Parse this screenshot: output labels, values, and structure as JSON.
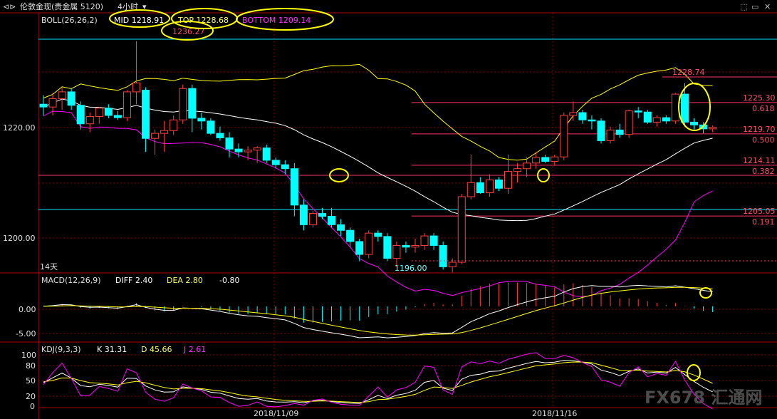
{
  "header": {
    "title": "伦敦金现(贵金属 5120)",
    "timeframe": "4小时",
    "timeframe_arrow": "▾",
    "nav_icon": "back-forward-icon",
    "window_icons": [
      "restore-icon",
      "window-icon",
      "close-icon"
    ]
  },
  "indicators": {
    "boll": {
      "label": "BOLL(26,26,2)",
      "mid": "MID 1218.91",
      "top": "TOP 1228.68",
      "bottom": "BOTTOM 1209.14"
    },
    "macd": {
      "label": "MACD(12,26,9)",
      "diff": "DIFF 2.40",
      "dea": "DEA 2.80",
      "macd": "-0.80"
    },
    "kdj": {
      "label": "KDJ(9,3,3)",
      "k": "K 31.31",
      "d": "D 45.66",
      "j": "J 2.61"
    }
  },
  "annotations": {
    "high": "1236.27",
    "high_right": "1228.74",
    "low": "1196.00",
    "span": "14天",
    "levels": [
      {
        "value": "1225.30",
        "fib": "0.618"
      },
      {
        "value": "1219.70",
        "fib": "0.500"
      },
      {
        "value": "1214.11",
        "fib": "0.382"
      },
      {
        "value": "1205.05",
        "fib": "0.191"
      }
    ],
    "fib_base": "1233.70"
  },
  "axis": {
    "price_ticks": [
      "1220.00",
      "1200.00"
    ],
    "macd_ticks": [
      "0.00",
      "-5.00"
    ],
    "kdj_ticks": [
      "100",
      "80",
      "50",
      "20",
      "0"
    ],
    "dates": [
      "2018/11/09",
      "2018/11/16"
    ]
  },
  "watermark": "FX678 汇通网",
  "colors": {
    "up": "#ff4040",
    "down": "#00ffff",
    "mid": "#ffffff",
    "upper": "#ffff00",
    "lower": "#ff00ff",
    "grid": "#b00000",
    "circle": "#ffff00",
    "level": "#ff3366",
    "cyan_line": "#00ffff"
  },
  "chart_data": {
    "type": "candlestick",
    "candles": [
      {
        "o": 1225.0,
        "h": 1226.6,
        "l": 1223.0,
        "c": 1224.5
      },
      {
        "o": 1224.5,
        "h": 1227.0,
        "l": 1223.0,
        "c": 1226.0
      },
      {
        "o": 1226.0,
        "h": 1228.0,
        "l": 1224.0,
        "c": 1227.2
      },
      {
        "o": 1227.2,
        "h": 1227.8,
        "l": 1224.0,
        "c": 1224.8
      },
      {
        "o": 1224.8,
        "h": 1225.5,
        "l": 1220.5,
        "c": 1221.5
      },
      {
        "o": 1221.5,
        "h": 1223.5,
        "l": 1220.0,
        "c": 1222.8
      },
      {
        "o": 1222.8,
        "h": 1224.5,
        "l": 1221.5,
        "c": 1224.3
      },
      {
        "o": 1224.3,
        "h": 1225.0,
        "l": 1222.5,
        "c": 1223.0
      },
      {
        "o": 1223.0,
        "h": 1223.8,
        "l": 1222.2,
        "c": 1222.6
      },
      {
        "o": 1222.6,
        "h": 1227.5,
        "l": 1222.0,
        "c": 1227.2
      },
      {
        "o": 1227.2,
        "h": 1236.27,
        "l": 1225.0,
        "c": 1228.8
      },
      {
        "o": 1227.5,
        "h": 1228.0,
        "l": 1216.5,
        "c": 1218.9
      },
      {
        "o": 1218.9,
        "h": 1220.5,
        "l": 1216.0,
        "c": 1219.8
      },
      {
        "o": 1219.8,
        "h": 1222.0,
        "l": 1216.5,
        "c": 1220.3
      },
      {
        "o": 1220.3,
        "h": 1223.0,
        "l": 1219.5,
        "c": 1222.2
      },
      {
        "o": 1222.2,
        "h": 1228.5,
        "l": 1221.5,
        "c": 1227.8
      },
      {
        "o": 1227.8,
        "h": 1228.5,
        "l": 1220.0,
        "c": 1222.5
      },
      {
        "o": 1222.5,
        "h": 1223.5,
        "l": 1220.5,
        "c": 1222.0
      },
      {
        "o": 1222.0,
        "h": 1222.5,
        "l": 1219.5,
        "c": 1219.8
      },
      {
        "o": 1219.8,
        "h": 1221.0,
        "l": 1218.5,
        "c": 1219.0
      },
      {
        "o": 1219.0,
        "h": 1220.0,
        "l": 1215.5,
        "c": 1217.0
      },
      {
        "o": 1217.0,
        "h": 1218.0,
        "l": 1215.5,
        "c": 1216.5
      },
      {
        "o": 1216.5,
        "h": 1217.5,
        "l": 1215.0,
        "c": 1216.8
      },
      {
        "o": 1216.8,
        "h": 1217.5,
        "l": 1214.5,
        "c": 1217.2
      },
      {
        "o": 1217.2,
        "h": 1217.8,
        "l": 1214.5,
        "c": 1215.0
      },
      {
        "o": 1215.0,
        "h": 1215.5,
        "l": 1213.5,
        "c": 1214.2
      },
      {
        "o": 1214.2,
        "h": 1215.0,
        "l": 1212.5,
        "c": 1213.5
      },
      {
        "o": 1213.5,
        "h": 1214.5,
        "l": 1205.0,
        "c": 1207.0
      },
      {
        "o": 1207.0,
        "h": 1208.0,
        "l": 1202.5,
        "c": 1203.5
      },
      {
        "o": 1203.5,
        "h": 1206.0,
        "l": 1203.0,
        "c": 1205.5
      },
      {
        "o": 1205.5,
        "h": 1206.5,
        "l": 1204.5,
        "c": 1205.0
      },
      {
        "o": 1205.0,
        "h": 1206.5,
        "l": 1203.0,
        "c": 1203.5
      },
      {
        "o": 1203.5,
        "h": 1204.5,
        "l": 1201.5,
        "c": 1202.5
      },
      {
        "o": 1202.5,
        "h": 1203.0,
        "l": 1199.5,
        "c": 1200.5
      },
      {
        "o": 1200.5,
        "h": 1201.0,
        "l": 1197.0,
        "c": 1198.2
      },
      {
        "o": 1198.2,
        "h": 1202.5,
        "l": 1197.5,
        "c": 1202.0
      },
      {
        "o": 1202.0,
        "h": 1202.5,
        "l": 1200.5,
        "c": 1201.4
      },
      {
        "o": 1201.4,
        "h": 1202.0,
        "l": 1197.0,
        "c": 1197.5
      },
      {
        "o": 1197.5,
        "h": 1200.5,
        "l": 1196.0,
        "c": 1199.8
      },
      {
        "o": 1199.8,
        "h": 1200.5,
        "l": 1198.5,
        "c": 1199.5
      },
      {
        "o": 1199.5,
        "h": 1201.0,
        "l": 1198.5,
        "c": 1199.8
      },
      {
        "o": 1199.8,
        "h": 1202.0,
        "l": 1199.0,
        "c": 1201.5
      },
      {
        "o": 1201.5,
        "h": 1202.0,
        "l": 1199.0,
        "c": 1199.8
      },
      {
        "o": 1199.8,
        "h": 1200.5,
        "l": 1195.5,
        "c": 1196.0
      },
      {
        "o": 1196.0,
        "h": 1197.5,
        "l": 1195.0,
        "c": 1196.8
      },
      {
        "o": 1196.8,
        "h": 1209.0,
        "l": 1196.5,
        "c": 1208.5
      },
      {
        "o": 1208.5,
        "h": 1216.0,
        "l": 1208.0,
        "c": 1211.0
      },
      {
        "o": 1211.0,
        "h": 1212.0,
        "l": 1209.0,
        "c": 1209.2
      },
      {
        "o": 1209.2,
        "h": 1212.5,
        "l": 1208.5,
        "c": 1211.5
      },
      {
        "o": 1211.5,
        "h": 1212.0,
        "l": 1209.5,
        "c": 1210.0
      },
      {
        "o": 1210.0,
        "h": 1216.0,
        "l": 1209.0,
        "c": 1213.0
      },
      {
        "o": 1213.0,
        "h": 1214.5,
        "l": 1211.0,
        "c": 1213.5
      },
      {
        "o": 1213.5,
        "h": 1215.5,
        "l": 1212.0,
        "c": 1214.5
      },
      {
        "o": 1214.5,
        "h": 1216.5,
        "l": 1213.5,
        "c": 1215.5
      },
      {
        "o": 1215.5,
        "h": 1216.0,
        "l": 1214.5,
        "c": 1214.8
      },
      {
        "o": 1214.8,
        "h": 1216.0,
        "l": 1214.0,
        "c": 1215.6
      },
      {
        "o": 1215.6,
        "h": 1223.5,
        "l": 1215.0,
        "c": 1223.0
      },
      {
        "o": 1223.0,
        "h": 1225.5,
        "l": 1222.0,
        "c": 1223.5
      },
      {
        "o": 1223.5,
        "h": 1224.0,
        "l": 1221.5,
        "c": 1222.2
      },
      {
        "o": 1222.2,
        "h": 1223.0,
        "l": 1220.5,
        "c": 1222.0
      },
      {
        "o": 1222.0,
        "h": 1222.5,
        "l": 1218.0,
        "c": 1218.5
      },
      {
        "o": 1218.5,
        "h": 1221.0,
        "l": 1218.0,
        "c": 1220.4
      },
      {
        "o": 1220.4,
        "h": 1221.5,
        "l": 1219.0,
        "c": 1219.6
      },
      {
        "o": 1219.6,
        "h": 1224.0,
        "l": 1219.0,
        "c": 1223.8
      },
      {
        "o": 1223.8,
        "h": 1224.5,
        "l": 1222.5,
        "c": 1223.6
      },
      {
        "o": 1223.6,
        "h": 1224.0,
        "l": 1221.5,
        "c": 1221.8
      },
      {
        "o": 1221.8,
        "h": 1223.0,
        "l": 1221.0,
        "c": 1222.6
      },
      {
        "o": 1222.6,
        "h": 1223.0,
        "l": 1221.5,
        "c": 1222.0
      },
      {
        "o": 1222.0,
        "h": 1227.0,
        "l": 1221.5,
        "c": 1226.8
      },
      {
        "o": 1226.8,
        "h": 1228.74,
        "l": 1221.0,
        "c": 1221.8
      },
      {
        "o": 1221.8,
        "h": 1222.5,
        "l": 1220.5,
        "c": 1221.3
      },
      {
        "o": 1221.3,
        "h": 1221.8,
        "l": 1219.8,
        "c": 1220.6
      },
      {
        "o": 1220.6,
        "h": 1221.2,
        "l": 1220.0,
        "c": 1220.9
      }
    ],
    "levels": [
      1233.7,
      1225.3,
      1219.7,
      1214.11,
      1205.05
    ],
    "ylim": [
      1194.9,
      1241.3
    ],
    "macd_ylim": [
      -6.3,
      3.9
    ],
    "kdj_ylim": [
      0,
      100
    ]
  }
}
